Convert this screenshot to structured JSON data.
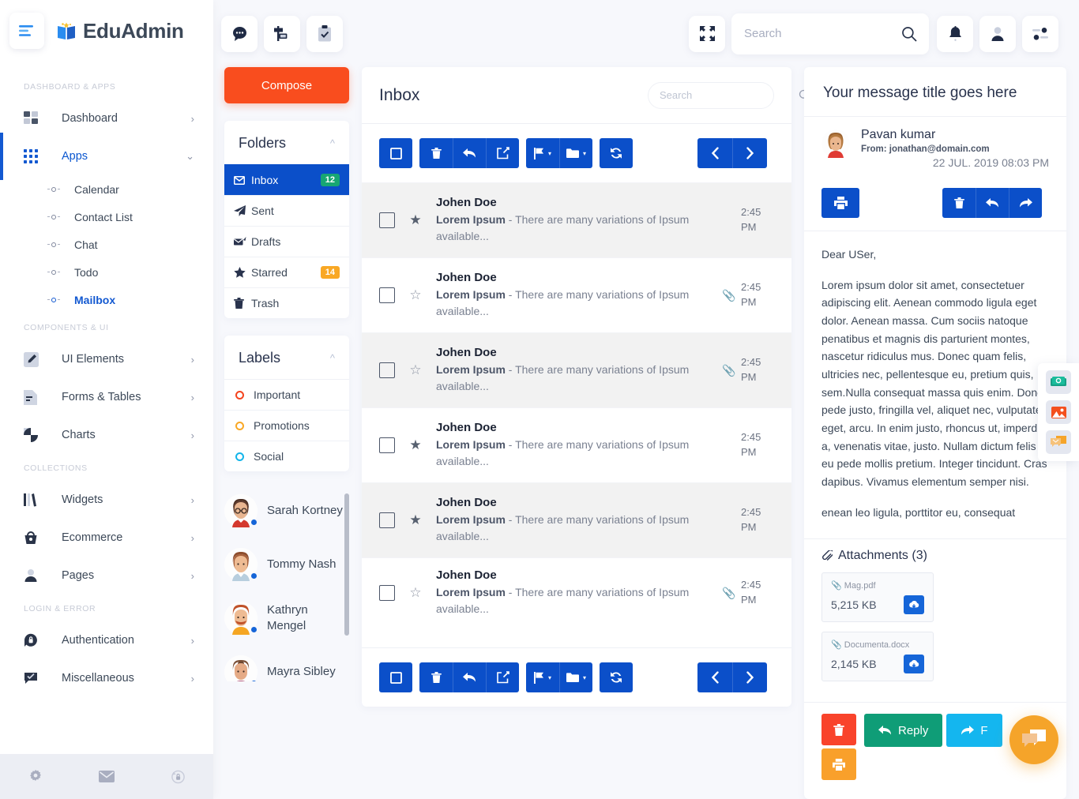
{
  "brand": {
    "name": "EduAdmin",
    "logo_icon": "book-logo-icon",
    "menu_icon": "hamburger-icon"
  },
  "sidebar": {
    "sections": [
      {
        "label": "DASHBOARD & APPS",
        "items": [
          {
            "label": "Dashboard",
            "icon": "grid-2x2-icon",
            "arrow": "›",
            "active": false
          },
          {
            "label": "Apps",
            "icon": "grid-3x3-icon",
            "arrow": "⌄",
            "active": true
          }
        ],
        "subitems": [
          {
            "label": "Calendar",
            "active": false
          },
          {
            "label": "Contact List",
            "active": false
          },
          {
            "label": "Chat",
            "active": false
          },
          {
            "label": "Todo",
            "active": false
          },
          {
            "label": "Mailbox",
            "active": true
          }
        ]
      },
      {
        "label": "COMPONENTS & UI",
        "items": [
          {
            "label": "UI Elements",
            "icon": "pencil-square-icon",
            "arrow": "›",
            "active": false
          },
          {
            "label": "Forms & Tables",
            "icon": "document-icon",
            "arrow": "›",
            "active": false
          },
          {
            "label": "Charts",
            "icon": "pie-chart-icon",
            "arrow": "›",
            "active": false
          }
        ],
        "subitems": []
      },
      {
        "label": "COLLECTIONS",
        "items": [
          {
            "label": "Widgets",
            "icon": "books-icon",
            "arrow": "›",
            "active": false
          },
          {
            "label": "Ecommerce",
            "icon": "basket-icon",
            "arrow": "›",
            "active": false
          },
          {
            "label": "Pages",
            "icon": "user-icon",
            "arrow": "›",
            "active": false
          }
        ],
        "subitems": []
      },
      {
        "label": "LOGIN & ERROR",
        "items": [
          {
            "label": "Authentication",
            "icon": "lock-circle-icon",
            "arrow": "›",
            "active": false
          },
          {
            "label": "Miscellaneous",
            "icon": "chat-check-icon",
            "arrow": "›",
            "active": false
          }
        ],
        "subitems": []
      }
    ],
    "footer_icons": [
      "gear-icon",
      "envelope-icon",
      "lock-reset-icon"
    ]
  },
  "topbar": {
    "left_icons": [
      "chat-bubble-icon",
      "signpost-icon",
      "clipboard-check-icon"
    ],
    "fullscreen_icon": "fullscreen-icon",
    "search": {
      "placeholder": "Search",
      "value": "",
      "icon": "search-icon"
    },
    "right_icons": [
      "bell-icon",
      "user-avatar-icon",
      "settings-sliders-icon"
    ]
  },
  "mail_sidebar": {
    "compose_label": "Compose",
    "folders": {
      "title": "Folders",
      "collapse_icon": "chevron-up-icon",
      "items": [
        {
          "label": "Inbox",
          "icon": "envelope-icon",
          "badge": "12",
          "badge_color": "#17a673",
          "active": true
        },
        {
          "label": "Sent",
          "icon": "paper-plane-icon",
          "badge": "",
          "badge_color": "",
          "active": false
        },
        {
          "label": "Drafts",
          "icon": "draft-mail-icon",
          "badge": "",
          "badge_color": "",
          "active": false
        },
        {
          "label": "Starred",
          "icon": "star-icon",
          "badge": "14",
          "badge_color": "#f9a825",
          "active": false
        },
        {
          "label": "Trash",
          "icon": "trash-icon",
          "badge": "",
          "badge_color": "",
          "active": false
        }
      ]
    },
    "labels": {
      "title": "Labels",
      "collapse_icon": "chevron-up-icon",
      "items": [
        {
          "label": "Important",
          "color": "#f4441e"
        },
        {
          "label": "Promotions",
          "color": "#f9a825"
        },
        {
          "label": "Social",
          "color": "#13b5ea"
        }
      ]
    },
    "contacts": [
      {
        "name": "Sarah Kortney",
        "online": true
      },
      {
        "name": "Tommy Nash",
        "online": true
      },
      {
        "name": "Kathryn Mengel",
        "online": true
      },
      {
        "name": "Mayra Sibley",
        "online": true
      }
    ]
  },
  "inbox": {
    "title": "Inbox",
    "search": {
      "placeholder": "Search",
      "value": "",
      "icon": "search-icon"
    },
    "toolbar": {
      "select_all_icon": "checkbox-icon",
      "delete_icon": "trash-icon",
      "reply_icon": "reply-arrow-icon",
      "forward_icon": "share-arrow-icon",
      "flag_icon": "flag-icon",
      "folder_icon": "folder-icon",
      "refresh_icon": "refresh-icon",
      "prev_icon": "chevron-left-icon",
      "next_icon": "chevron-right-icon",
      "caret": "▾"
    },
    "rows": [
      {
        "sender": "Johen Doe",
        "subject": "Lorem Ipsum",
        "preview": " - There are many variations of Ipsum available...",
        "time": "2:45 PM",
        "starred": true,
        "attachment": false,
        "alt": true
      },
      {
        "sender": "Johen Doe",
        "subject": "Lorem Ipsum",
        "preview": " - There are many variations of Ipsum available...",
        "time": "2:45 PM",
        "starred": false,
        "attachment": true,
        "alt": false
      },
      {
        "sender": "Johen Doe",
        "subject": "Lorem Ipsum",
        "preview": " - There are many variations of Ipsum available...",
        "time": "2:45 PM",
        "starred": false,
        "attachment": true,
        "alt": true
      },
      {
        "sender": "Johen Doe",
        "subject": "Lorem Ipsum",
        "preview": " - There are many variations of Ipsum available...",
        "time": "2:45 PM",
        "starred": true,
        "attachment": false,
        "alt": false
      },
      {
        "sender": "Johen Doe",
        "subject": "Lorem Ipsum",
        "preview": " - There are many variations of Ipsum available...",
        "time": "2:45 PM",
        "starred": true,
        "attachment": false,
        "alt": true
      },
      {
        "sender": "Johen Doe",
        "subject": "Lorem Ipsum",
        "preview": " - There are many variations of Ipsum available...",
        "time": "2:45 PM",
        "starred": false,
        "attachment": true,
        "alt": false
      }
    ]
  },
  "message": {
    "title": "Your message title goes here",
    "sender": "Pavan kumar",
    "from": "From: jonathan@domain.com",
    "date": "22 JUL. 2019 08:03 PM",
    "print_icon": "printer-icon",
    "delete_icon": "trash-icon",
    "reply_icon": "reply-arrow-icon",
    "forward_icon": "forward-arrow-icon",
    "greeting": "Dear USer,",
    "paragraph1": "Lorem ipsum dolor sit amet, consectetuer adipiscing elit. Aenean commodo ligula eget dolor. Aenean massa. Cum sociis natoque penatibus et magnis dis parturient montes, nascetur ridiculus mus. Donec quam felis, ultricies nec, pellentesque eu, pretium quis, sem.Nulla consequat massa quis enim. Donec pede justo, fringilla vel, aliquet nec, vulputate eget, arcu. In enim justo, rhoncus ut, imperdiet a, venenatis vitae, justo. Nullam dictum felis eu pede mollis pretium. Integer tincidunt. Cras dapibus. Vivamus elementum semper nisi.",
    "paragraph2": "enean leo ligula, porttitor eu, consequat",
    "attachments": {
      "heading": "Attachments (3)",
      "heading_icon": "paperclip-icon",
      "items": [
        {
          "name": "Mag.pdf",
          "size": "5,215 KB",
          "icon": "paperclip-icon",
          "download_icon": "cloud-download-icon"
        },
        {
          "name": "Documenta.docx",
          "size": "2,145 KB",
          "icon": "paperclip-icon",
          "download_icon": "cloud-download-icon"
        }
      ]
    },
    "footer": {
      "delete_label": "",
      "delete_icon": "trash-icon",
      "delete_color": "#f9432b",
      "print_icon": "printer-icon",
      "print_color": "#f9a02b",
      "reply_label": "Reply",
      "reply_icon": "reply-arrow-icon",
      "reply_color": "#0f9d77",
      "forward_label": "F",
      "forward_icon": "forward-arrow-icon",
      "forward_color": "#14b6ef"
    }
  },
  "floaters": {
    "dock": [
      "money-icon",
      "image-icon",
      "message-icon"
    ],
    "fab_icon": "chat-bubbles-icon"
  },
  "colors": {
    "primary_blue": "#0b4fc9",
    "accent_orange": "#f94d1e",
    "fab_orange": "#f5a42a",
    "green_badge": "#17a673",
    "amber_badge": "#f9a825"
  }
}
